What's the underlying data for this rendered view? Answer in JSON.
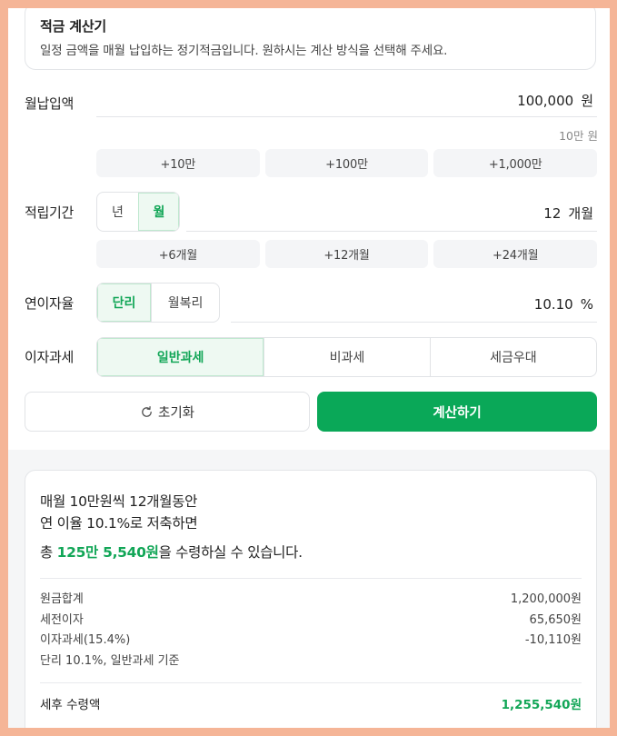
{
  "info": {
    "title": "적금 계산기",
    "description": "일정 금액을 매월 납입하는 정기적금입니다. 원하시는 계산 방식을 선택해 주세요."
  },
  "monthly_deposit": {
    "label": "월납입액",
    "value": "100,000",
    "unit": "원",
    "hint": "10만 원",
    "quick_add": [
      "+10만",
      "+100만",
      "+1,000만"
    ]
  },
  "period": {
    "label": "적립기간",
    "options": [
      "년",
      "월"
    ],
    "selected": "월",
    "value": "12",
    "unit": "개월",
    "quick_add": [
      "+6개월",
      "+12개월",
      "+24개월"
    ]
  },
  "interest_rate": {
    "label": "연이자율",
    "options": [
      "단리",
      "월복리"
    ],
    "selected": "단리",
    "value": "10.10",
    "unit": "%"
  },
  "tax": {
    "label": "이자과세",
    "options": [
      "일반과세",
      "비과세",
      "세금우대"
    ],
    "selected": "일반과세"
  },
  "actions": {
    "reset_label": "초기화",
    "calculate_label": "계산하기"
  },
  "result": {
    "summary_line1": "매월 10만원씩 12개월동안",
    "summary_line2": "연 이율 10.1%로 저축하면",
    "total_prefix": "총 ",
    "total_amount": "125만 5,540원",
    "total_suffix": "을 수령하실 수 있습니다.",
    "rows": [
      {
        "label": "원금합계",
        "value": "1,200,000원"
      },
      {
        "label": "세전이자",
        "value": "65,650원"
      },
      {
        "label": "이자과세(15.4%)",
        "value": "-10,110원"
      }
    ],
    "note": "단리 10.1%, 일반과세 기준",
    "final_label": "세후 수령액",
    "final_value": "1,255,540원"
  },
  "colors": {
    "accent": "#0aa858",
    "accent_text": "#12a657",
    "background_border": "#f5b597"
  }
}
